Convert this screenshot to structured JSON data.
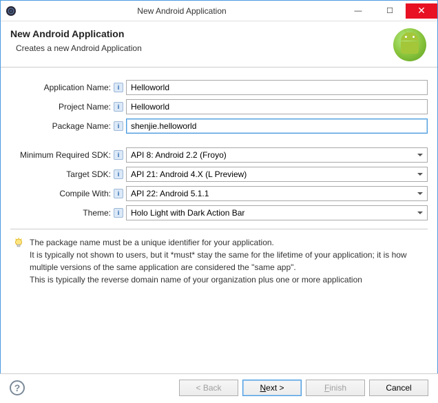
{
  "window": {
    "title": "New Android Application"
  },
  "header": {
    "title": "New Android Application",
    "subtitle": "Creates a new Android Application"
  },
  "form": {
    "app_name_label": "Application Name:",
    "app_name_value": "Helloworld",
    "project_name_label": "Project Name:",
    "project_name_value": "Helloworld",
    "package_name_label": "Package Name:",
    "package_name_value": "shenjie.helloworld",
    "min_sdk_label": "Minimum Required SDK:",
    "min_sdk_value": "API 8: Android 2.2 (Froyo)",
    "target_sdk_label": "Target SDK:",
    "target_sdk_value": "API 21: Android 4.X (L Preview)",
    "compile_with_label": "Compile With:",
    "compile_with_value": "API 22: Android 5.1.1",
    "theme_label": "Theme:",
    "theme_value": "Holo Light with Dark Action Bar"
  },
  "tip": {
    "line1": "The package name must be a unique identifier for your application.",
    "line2": "It is typically not shown to users, but it *must* stay the same for the lifetime of your application; it is how multiple versions of the same application are considered the \"same app\".",
    "line3": "This is typically the reverse domain name of your organization plus one or more application"
  },
  "buttons": {
    "back": "< Back",
    "next_prefix": "N",
    "next_suffix": "ext >",
    "finish_prefix": "F",
    "finish_suffix": "inish",
    "cancel": "Cancel"
  }
}
